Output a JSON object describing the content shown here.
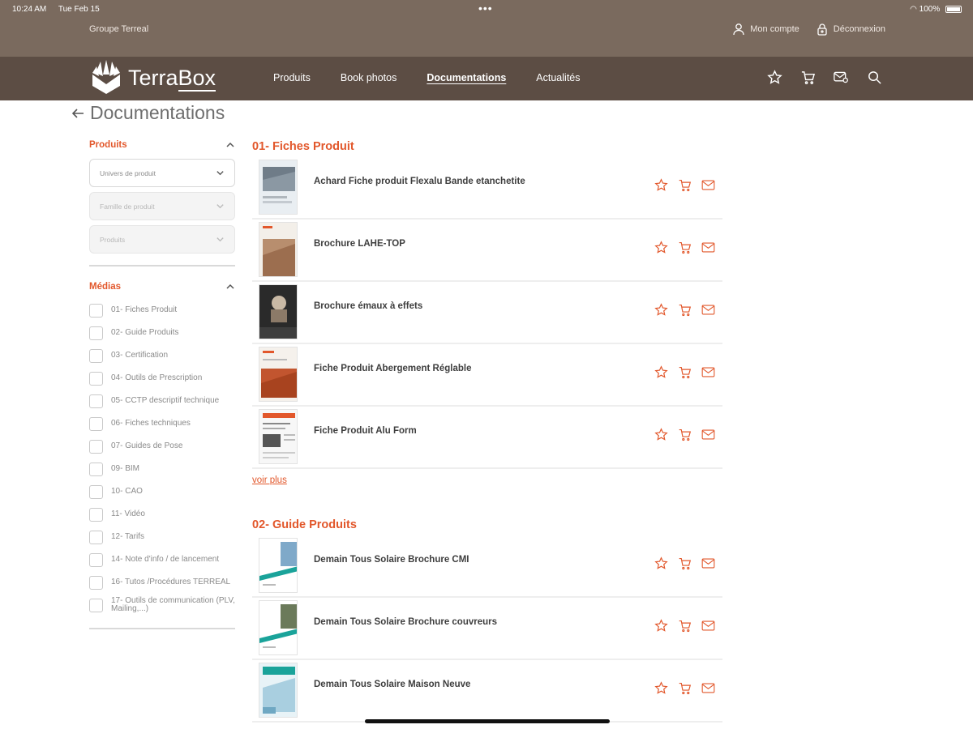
{
  "status_bar": {
    "time": "10:24 AM",
    "date": "Tue Feb 15",
    "battery": "100%"
  },
  "header": {
    "group_name": "Groupe Terreal",
    "account_label": "Mon compte",
    "logout_label": "Déconnexion"
  },
  "brand": {
    "logo_text_1": "Terra",
    "logo_text_2": "Box"
  },
  "nav": {
    "items": [
      {
        "label": "Produits"
      },
      {
        "label": "Book photos"
      },
      {
        "label": "Documentations"
      },
      {
        "label": "Actualités"
      }
    ],
    "active": "Documentations"
  },
  "page": {
    "title": "Documentations"
  },
  "sidebar": {
    "produits": {
      "title": "Produits",
      "selects": [
        {
          "placeholder": "Univers de produit"
        },
        {
          "placeholder": "Famille de produit"
        },
        {
          "placeholder": "Produits"
        }
      ]
    },
    "medias": {
      "title": "Médias",
      "items": [
        {
          "label": "01- Fiches Produit"
        },
        {
          "label": "02- Guide Produits"
        },
        {
          "label": "03- Certification"
        },
        {
          "label": "04- Outils de Prescription"
        },
        {
          "label": "05- CCTP descriptif technique"
        },
        {
          "label": "06- Fiches techniques"
        },
        {
          "label": "07- Guides de Pose"
        },
        {
          "label": "09- BIM"
        },
        {
          "label": "10- CAO"
        },
        {
          "label": "11- Vidéo"
        },
        {
          "label": "12- Tarifs"
        },
        {
          "label": "14- Note d'info / de lancement"
        },
        {
          "label": "16- Tutos /Procédures TERREAL"
        },
        {
          "label": "17- Outils de communication (PLV, Mailing,...)"
        }
      ]
    }
  },
  "sections": [
    {
      "title": "01- Fiches Produit",
      "docs": [
        {
          "title": "Achard Fiche produit Flexalu Bande etanchetite"
        },
        {
          "title": "Brochure LAHE-TOP"
        },
        {
          "title": "Brochure émaux à effets"
        },
        {
          "title": "Fiche Produit Abergement Réglable"
        },
        {
          "title": "Fiche Produit Alu Form"
        }
      ],
      "see_more": "voir plus"
    },
    {
      "title": "02- Guide Produits",
      "docs": [
        {
          "title": "Demain Tous Solaire Brochure CMI"
        },
        {
          "title": "Demain Tous Solaire Brochure couvreurs"
        },
        {
          "title": "Demain Tous Solaire Maison Neuve"
        }
      ]
    }
  ],
  "colors": {
    "top_band": "#7a6a5e",
    "nav_bar": "#5c4d44",
    "accent": "#e2572b"
  }
}
